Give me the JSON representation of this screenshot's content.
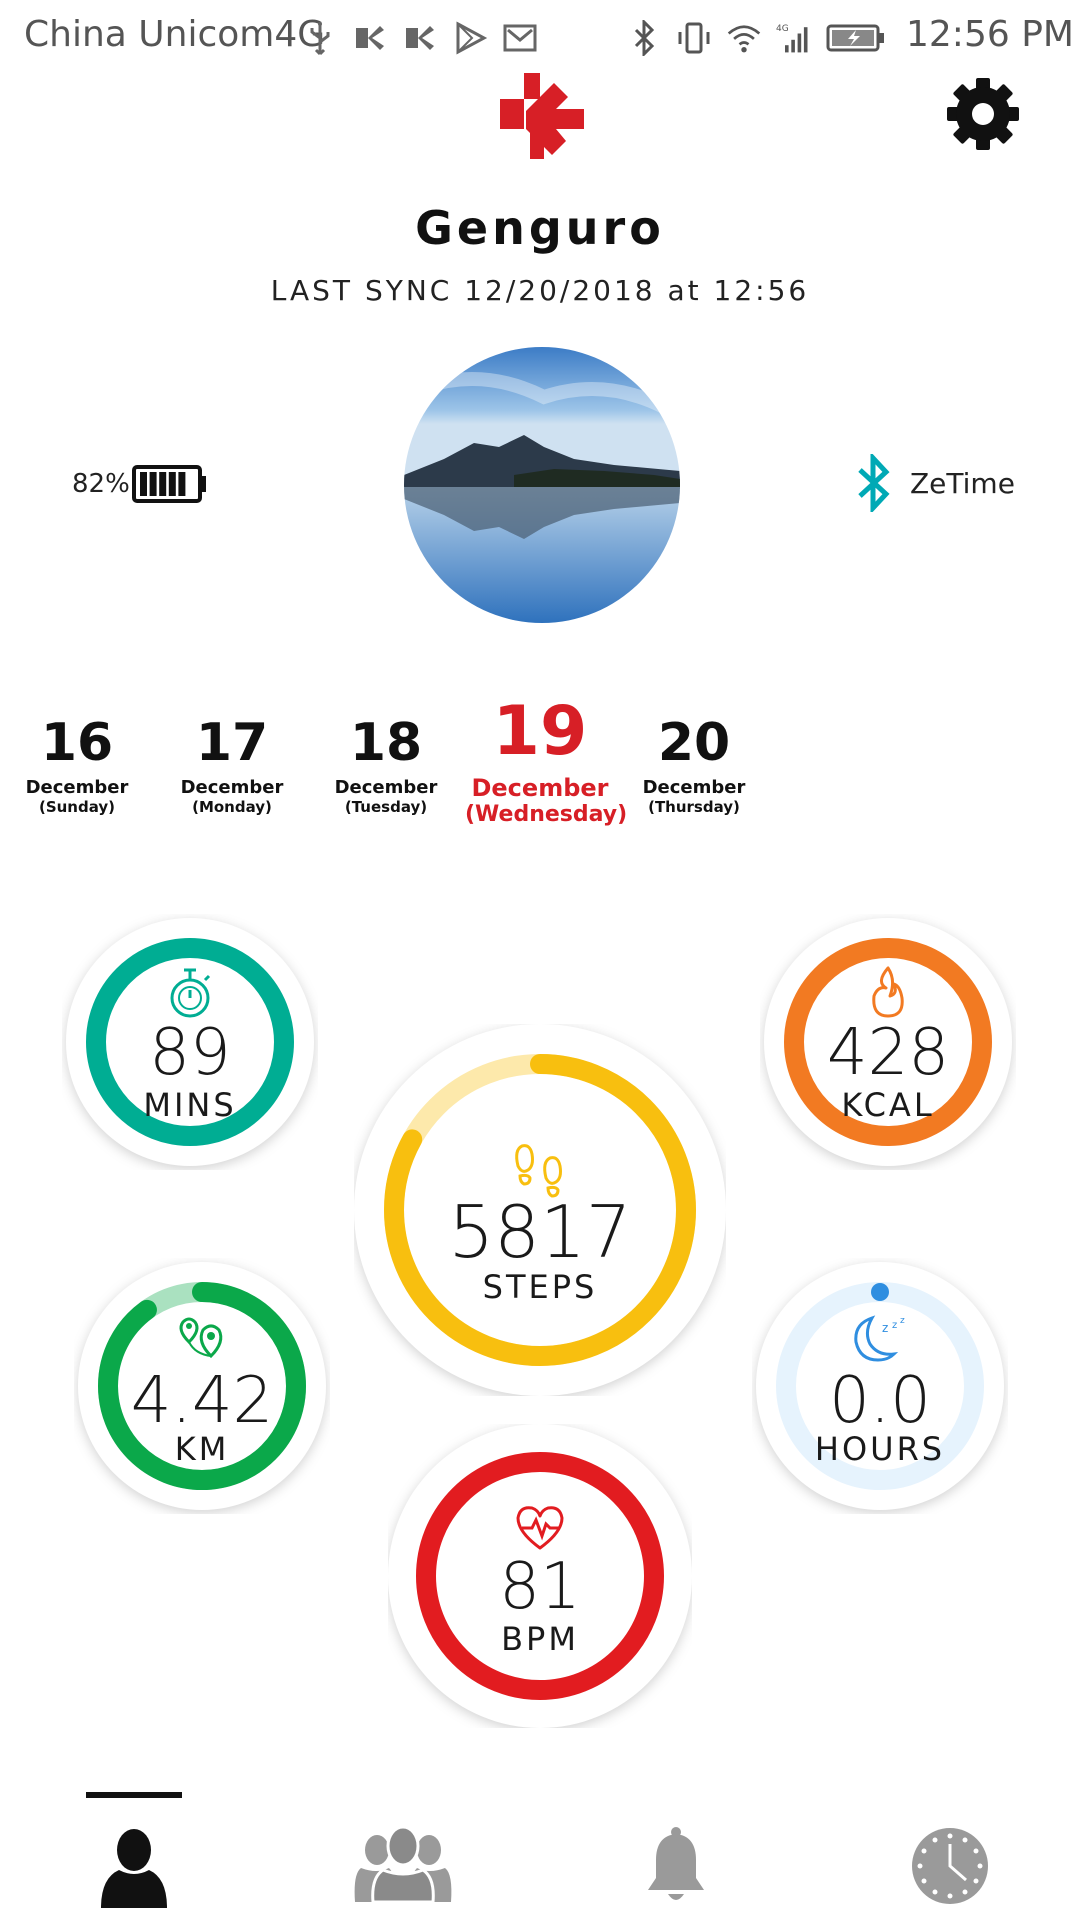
{
  "status_bar": {
    "carrier": "China Unicom4G",
    "time": "12:56 PM",
    "network": "4G"
  },
  "header": {
    "username": "Genguro",
    "last_sync": "LAST SYNC 12/20/2018 at 12:56",
    "logo_icon": "kronaby-k-logo",
    "settings_icon": "gear-icon",
    "brand_color": "#d71f26"
  },
  "device": {
    "battery": "82%",
    "battery_level": 0.82,
    "bluetooth_name": "ZeTime",
    "bluetooth_color": "#00a9b5"
  },
  "dates": [
    {
      "num": "16",
      "month": "December",
      "weekday": "(Sunday)"
    },
    {
      "num": "17",
      "month": "December",
      "weekday": "(Monday)"
    },
    {
      "num": "18",
      "month": "December",
      "weekday": "(Tuesday)"
    },
    {
      "num": "19",
      "month": "December",
      "weekday": "(Wednesday)",
      "active": true
    },
    {
      "num": "20",
      "month": "December",
      "weekday": "(Thursday)"
    }
  ],
  "metrics": {
    "activity": {
      "value": "89",
      "unit": "MINS",
      "icon": "stopwatch-icon",
      "color": "#00ad93",
      "progress": 1.0
    },
    "calories": {
      "value": "428",
      "unit": "KCAL",
      "icon": "flame-icon",
      "color": "#f27a22",
      "progress": 1.0
    },
    "steps": {
      "value": "5817",
      "unit": "STEPS",
      "icon": "footprints-icon",
      "color": "#f8bf0f",
      "progress": 0.83
    },
    "distance": {
      "value": "4.42",
      "unit": "KM",
      "icon": "location-pins-icon",
      "color": "#0ba84a",
      "progress": 0.9
    },
    "sleep": {
      "value": "0.0",
      "unit": "HOURS",
      "icon": "moon-zzz-icon",
      "color": "#b8dcfa",
      "progress": 0.0
    },
    "heart_rate": {
      "value": "81",
      "unit": "BPM",
      "icon": "heartbeat-icon",
      "color": "#e21c20",
      "progress": 1.0
    }
  },
  "nav": {
    "active": "profile",
    "items": [
      "profile-icon",
      "friends-icon",
      "notifications-icon",
      "watch-icon"
    ]
  }
}
